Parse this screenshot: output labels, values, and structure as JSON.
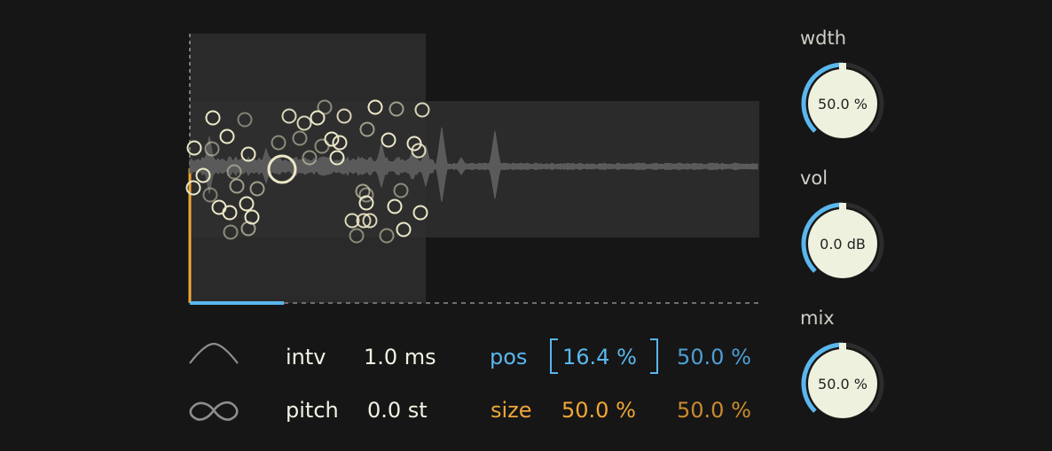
{
  "knobs": [
    {
      "id": "wdth",
      "label": "wdth",
      "value_text": "50.0 %",
      "value": 0.5
    },
    {
      "id": "vol",
      "label": "vol",
      "value_text": "0.0 dB",
      "value": 0.5
    },
    {
      "id": "mix",
      "label": "mix",
      "value_text": "50.0 %",
      "value": 0.5
    }
  ],
  "params": {
    "intv": {
      "label": "intv",
      "value": "1.0 ms"
    },
    "pitch": {
      "label": "pitch",
      "value": "0.0 st"
    },
    "pos": {
      "label": "pos",
      "value": "16.4 %",
      "spread": "50.0 %"
    },
    "size": {
      "label": "size",
      "value": "50.0 %",
      "spread": "50.0 %"
    }
  },
  "icons": {
    "envelope": "envelope-curve-icon",
    "loop": "infinity-loop-icon"
  },
  "colors": {
    "background": "#161616",
    "accent_blue": "#5ab7ee",
    "accent_orange": "#f0a638",
    "knob_face": "#eef1dd",
    "grain": "#ece8c8"
  }
}
